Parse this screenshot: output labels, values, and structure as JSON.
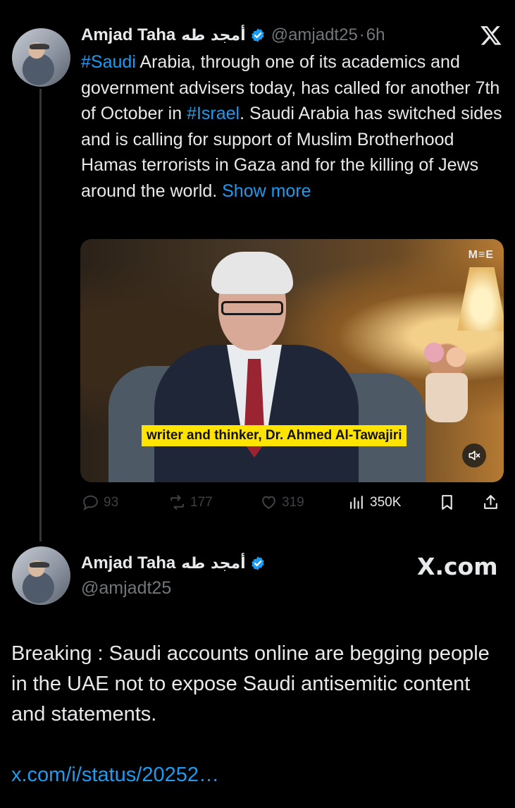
{
  "tweet": {
    "author_name": "Amjad Taha",
    "author_name_arabic": "أمجد طه",
    "handle": "@amjadt25",
    "time": "6h",
    "separator": "·",
    "text_segments": {
      "h1": "#Saudi",
      "t1": " Arabia, through one of its academics and government advisers today, has called for another 7th of October in ",
      "h2": "#Israel",
      "t2": ". Saudi Arabia has switched sides and is calling for support of Muslim Brotherhood Hamas terrorists in Gaza and for the killing of Jews around the world. ",
      "show_more": "Show more"
    },
    "media": {
      "watermark": "M≡E",
      "caption": "writer and thinker, Dr. Ahmed Al-Tawajiri"
    },
    "actions": {
      "replies": "93",
      "reposts": "177",
      "likes": "319",
      "views": "350K"
    }
  },
  "card": {
    "author_name": "Amjad Taha",
    "author_name_arabic": "أمجد طه",
    "handle": "@amjadt25",
    "brand": "X.com",
    "text": "Breaking : Saudi accounts online are begging people in the UAE not to expose Saudi antisemitic content and statements.",
    "link": "x.com/i/status/20252…"
  },
  "colors": {
    "background": "#000000",
    "link": "#1d9bf0",
    "muted": "#71767b",
    "caption_bg": "#ffe400"
  },
  "icons": [
    "avatar",
    "verified-badge-icon",
    "x-logo-icon",
    "mute-icon",
    "reply-icon",
    "repost-icon",
    "like-icon",
    "views-icon",
    "bookmark-icon",
    "share-icon"
  ]
}
